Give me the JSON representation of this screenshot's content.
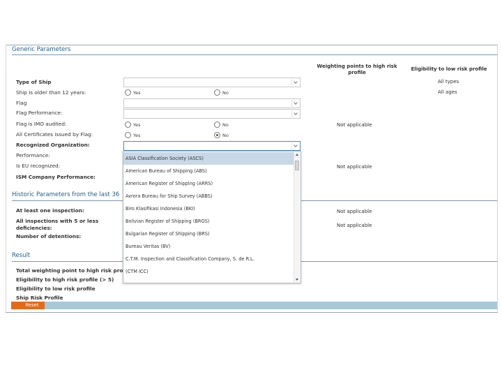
{
  "sections": {
    "generic": "Generic Parameters",
    "historic": "Historic Parameters from the last 36",
    "result": "Result"
  },
  "columns": {
    "weighting": "Weighting points to high risk profile",
    "eligibility": "Eligibility to low risk profile"
  },
  "generic": {
    "type_of_ship": "Type of Ship",
    "older_12": "Ship is older than 12 years:",
    "flag": "Flag",
    "flag_performance": "Flag Performance:",
    "flag_imo": "Flag is IMO audited:",
    "all_certs": "All Certificates issued by Flag:",
    "recognized_org": "Recognized Organization:",
    "performance": "Performance:",
    "eu_recognized": "Is EU recognized:",
    "ism": "ISM Company Performance:"
  },
  "radio": {
    "yes": "Yes",
    "no": "No"
  },
  "right_values": {
    "all_types": "All types",
    "all_ages": "All ages"
  },
  "not_applicable": "Not applicable",
  "historic": {
    "inspection": "At least one inspection:",
    "deficiencies": "All inspections with 5 or less deficiencies:",
    "detentions": "Number of detentions:"
  },
  "result": {
    "total": "Total weighting point to high risk prof",
    "high": "Eligibility to high risk profile (> 5)",
    "low": "Eligibility to low risk profile",
    "srp": "Ship Risk Profile"
  },
  "reset_label": "Reset",
  "ro_options": [
    "ASIA Classification Society (ASCS)",
    "American Bureau of Shipping (ABS)",
    "American Register of Shipping (ARRS)",
    "Avrora Bureau for Ship Survey (ABBS)",
    "Biro Klasifikasi Indonesia (BKI)",
    "Bolivian Register of Shipping (BROS)",
    "Bulgarian Register of Shipping (BRS)",
    "Bureau Veritas (BV)",
    "C.T.M. Inspection and Classification Company, S. de R.L.",
    "(CTM ICC)"
  ]
}
